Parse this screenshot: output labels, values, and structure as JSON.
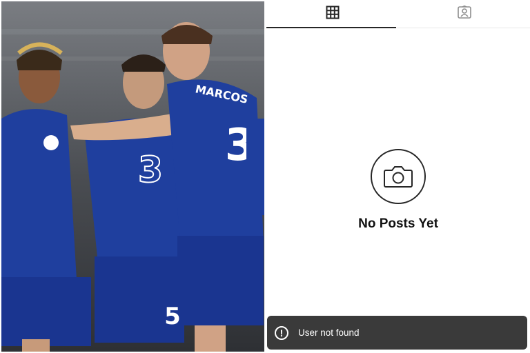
{
  "photo": {
    "alt": "Chelsea players celebrating",
    "jersey_number_front": "3",
    "jersey_number_back": "5",
    "player_name": "MARCOS"
  },
  "tabs": [
    {
      "name": "posts-grid",
      "icon": "grid-icon",
      "active": true
    },
    {
      "name": "tagged",
      "icon": "tagged-user-icon",
      "active": false
    }
  ],
  "empty_state": {
    "icon": "camera-icon",
    "title": "No Posts Yet"
  },
  "toast": {
    "icon": "exclamation-icon",
    "message": "User not found"
  },
  "colors": {
    "kit_blue": "#1f3f9e",
    "toast_bg": "#3a3a3a",
    "text": "#111111"
  }
}
